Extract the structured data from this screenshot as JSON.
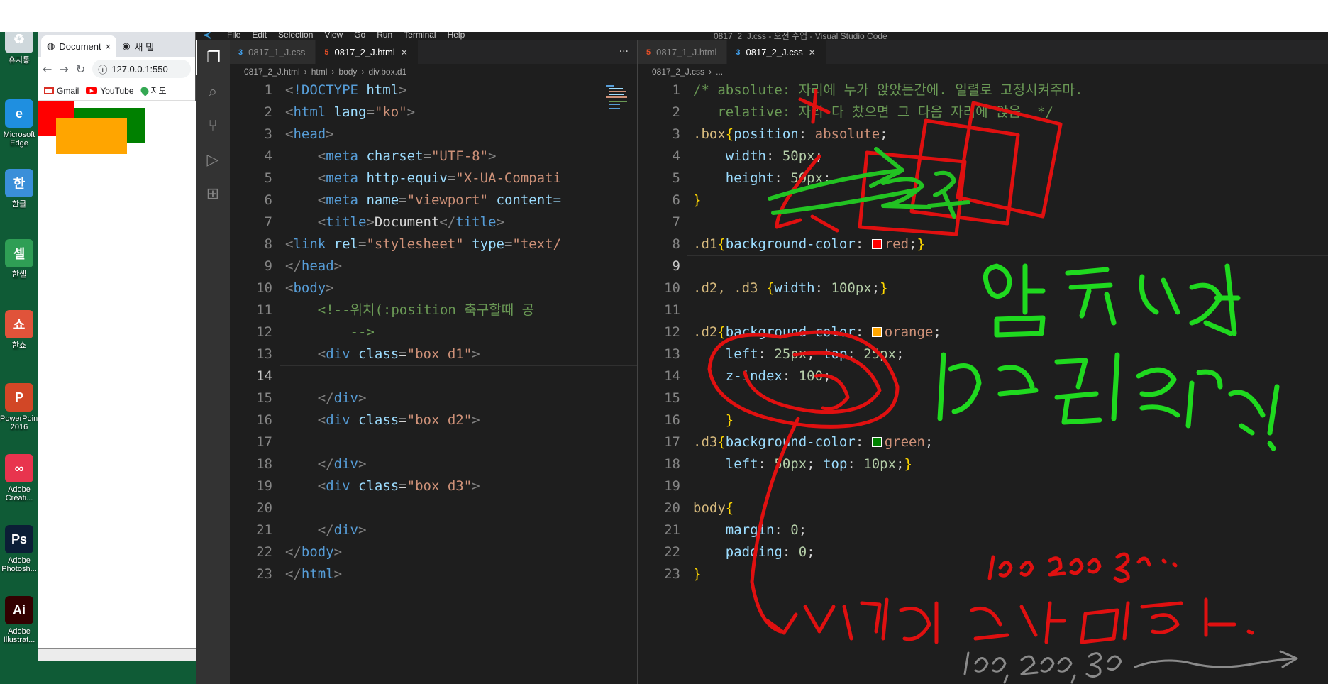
{
  "desktop": {
    "icons": [
      {
        "label": "휴지통",
        "icon": "recycle-bin-icon",
        "color": "#cfd8dc",
        "glyph": "♻"
      },
      {
        "label": "Microsoft Edge",
        "icon": "edge-icon",
        "color": "#1f8fe0",
        "glyph": "e"
      },
      {
        "label": "한글",
        "icon": "hangul-icon",
        "color": "#3a8fd9",
        "glyph": "한"
      },
      {
        "label": "한셀",
        "icon": "hancell-icon",
        "color": "#2f9e55",
        "glyph": "셀"
      },
      {
        "label": "한쇼",
        "icon": "hanshow-icon",
        "color": "#e0533a",
        "glyph": "쇼"
      },
      {
        "label": "PowerPoint 2016",
        "icon": "powerpoint-icon",
        "color": "#d24726",
        "glyph": "P"
      },
      {
        "label": "Adobe Creati...",
        "icon": "creative-cloud-icon",
        "color": "#e8344e",
        "glyph": "∞"
      },
      {
        "label": "Adobe Photosh...",
        "icon": "photoshop-icon",
        "color": "#0b1e36",
        "glyph": "Ps"
      },
      {
        "label": "Adobe Illustrat...",
        "icon": "illustrator-icon",
        "color": "#330000",
        "glyph": "Ai"
      }
    ]
  },
  "browser": {
    "tabs": [
      {
        "title": "Document",
        "close": "×"
      },
      {
        "title": "새 탭",
        "close": ""
      }
    ],
    "url": "127.0.0.1:550",
    "bookmarks": [
      "Gmail",
      "YouTube",
      "지도"
    ],
    "boxes": [
      {
        "name": "box-d1",
        "color": "red"
      },
      {
        "name": "box-d2",
        "color": "orange"
      },
      {
        "name": "box-d3",
        "color": "green"
      }
    ],
    "colors": {
      "red": "#ff0000",
      "orange": "#ffa500",
      "green": "#008000"
    }
  },
  "vscode": {
    "menu": [
      "File",
      "Edit",
      "Selection",
      "View",
      "Go",
      "Run",
      "Terminal",
      "Help"
    ],
    "window_title": "0817_2_J.css - 오전 수업 - Visual Studio Code",
    "left_pane": {
      "tabs": [
        {
          "label": "0817_1_J.css",
          "type": "css",
          "active": false
        },
        {
          "label": "0817_2_J.html",
          "type": "html",
          "active": true
        }
      ],
      "breadcrumb": [
        "0817_2_J.html",
        "html",
        "body",
        "div.box.d1"
      ],
      "current_line": 14
    },
    "right_pane": {
      "tabs": [
        {
          "label": "0817_1_J.html",
          "type": "html",
          "active": false
        },
        {
          "label": "0817_2_J.css",
          "type": "css",
          "active": true
        }
      ],
      "breadcrumb": [
        "0817_2_J.css",
        "..."
      ],
      "current_line": 9
    }
  },
  "annotations": {
    "handwritten": [
      "z축",
      "앞 뒤 순서 바꾸는 방법!",
      "100 200 300 ...",
      "백단위로 준다 보니 편함.",
      "100, 200, 300"
    ]
  }
}
